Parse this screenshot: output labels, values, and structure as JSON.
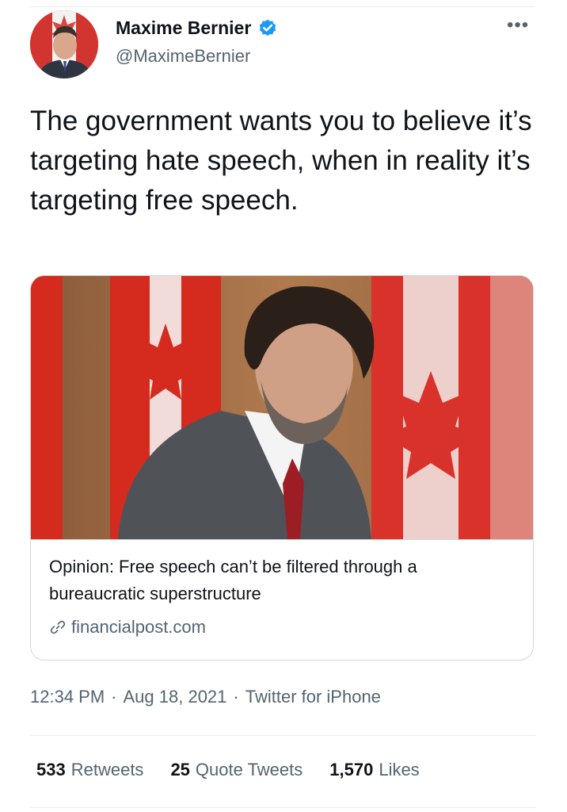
{
  "author": {
    "display_name": "Maxime Bernier",
    "handle": "@MaximeBernier",
    "verified_icon": "verified-badge-icon",
    "avatar": "avatar"
  },
  "more_icon": "more-horizontal-icon",
  "more_glyph": "•••",
  "tweet": {
    "text": "The government wants you to believe it’s targeting hate speech, when in reality it’s targeting free speech."
  },
  "card": {
    "title": "Opinion: Free speech can’t be filtered through a bureaucratic superstructure",
    "domain": "financialpost.com",
    "link_icon": "link-icon"
  },
  "meta": {
    "time": "12:34 PM",
    "sep1": "·",
    "date": "Aug 18, 2021",
    "sep2": "·",
    "source": "Twitter for iPhone"
  },
  "stats": {
    "retweets_count": "533",
    "retweets_label": "Retweets",
    "quotes_count": "25",
    "quotes_label": "Quote Tweets",
    "likes_count": "1,570",
    "likes_label": "Likes"
  },
  "colors": {
    "verified": "#1d9bf0",
    "secondary_text": "#536471",
    "primary_text": "#0f1419",
    "flag_red": "#d52b1e"
  }
}
